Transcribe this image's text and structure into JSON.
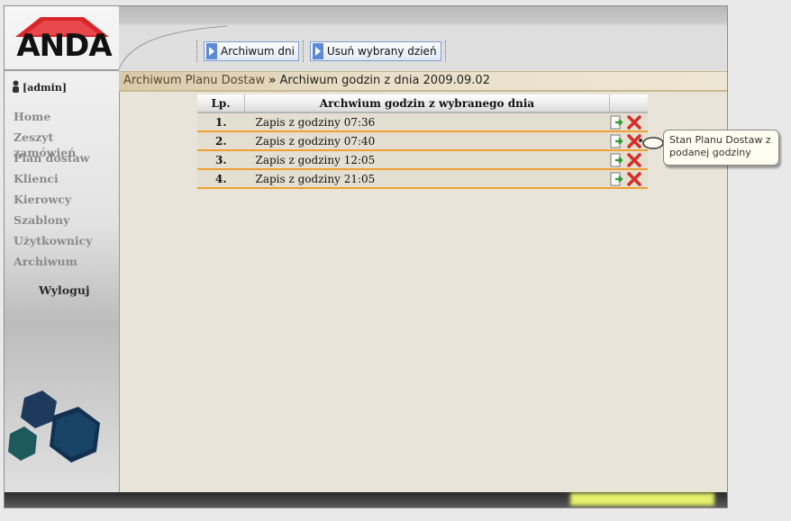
{
  "brand": {
    "logo_text": "ANDA"
  },
  "user": {
    "label": "[admin]"
  },
  "sidebar": {
    "items": [
      {
        "label": "Home"
      },
      {
        "label": "Zeszyt zamówień"
      },
      {
        "label": "Plan dostaw"
      },
      {
        "label": "Klienci"
      },
      {
        "label": "Kierowcy"
      },
      {
        "label": "Szablony"
      },
      {
        "label": "Użytkownicy"
      },
      {
        "label": "Archiwum"
      }
    ],
    "logout_label": "Wyloguj"
  },
  "toolbar": {
    "archive_days_label": "Archiwum dni",
    "delete_day_label": "Usuń wybrany dzień"
  },
  "breadcrumb": {
    "section": "Archiwum Planu Dostaw",
    "separator": "»",
    "current": "Archiwum godzin z dnia 2009.09.02"
  },
  "table": {
    "columns": [
      "Lp.",
      "Archwium godzin z wybranego dnia",
      ""
    ],
    "rows": [
      {
        "lp": "1.",
        "label": "Zapis z godziny 07:36"
      },
      {
        "lp": "2.",
        "label": "Zapis z godziny 07:40"
      },
      {
        "lp": "3.",
        "label": "Zapis z godziny 12:05"
      },
      {
        "lp": "4.",
        "label": "Zapis z godziny 21:05"
      }
    ],
    "row_icons": [
      "view-record-icon",
      "delete-icon"
    ]
  },
  "tooltip": {
    "text": "Stan Planu Dostaw z podanej godziny"
  },
  "colors": {
    "accent_orange": "#f0a030",
    "row_bg": "#e5dfd2",
    "delete_red": "#e03a2a",
    "view_green": "#3aa33a",
    "button_border": "#7d9ccb"
  }
}
